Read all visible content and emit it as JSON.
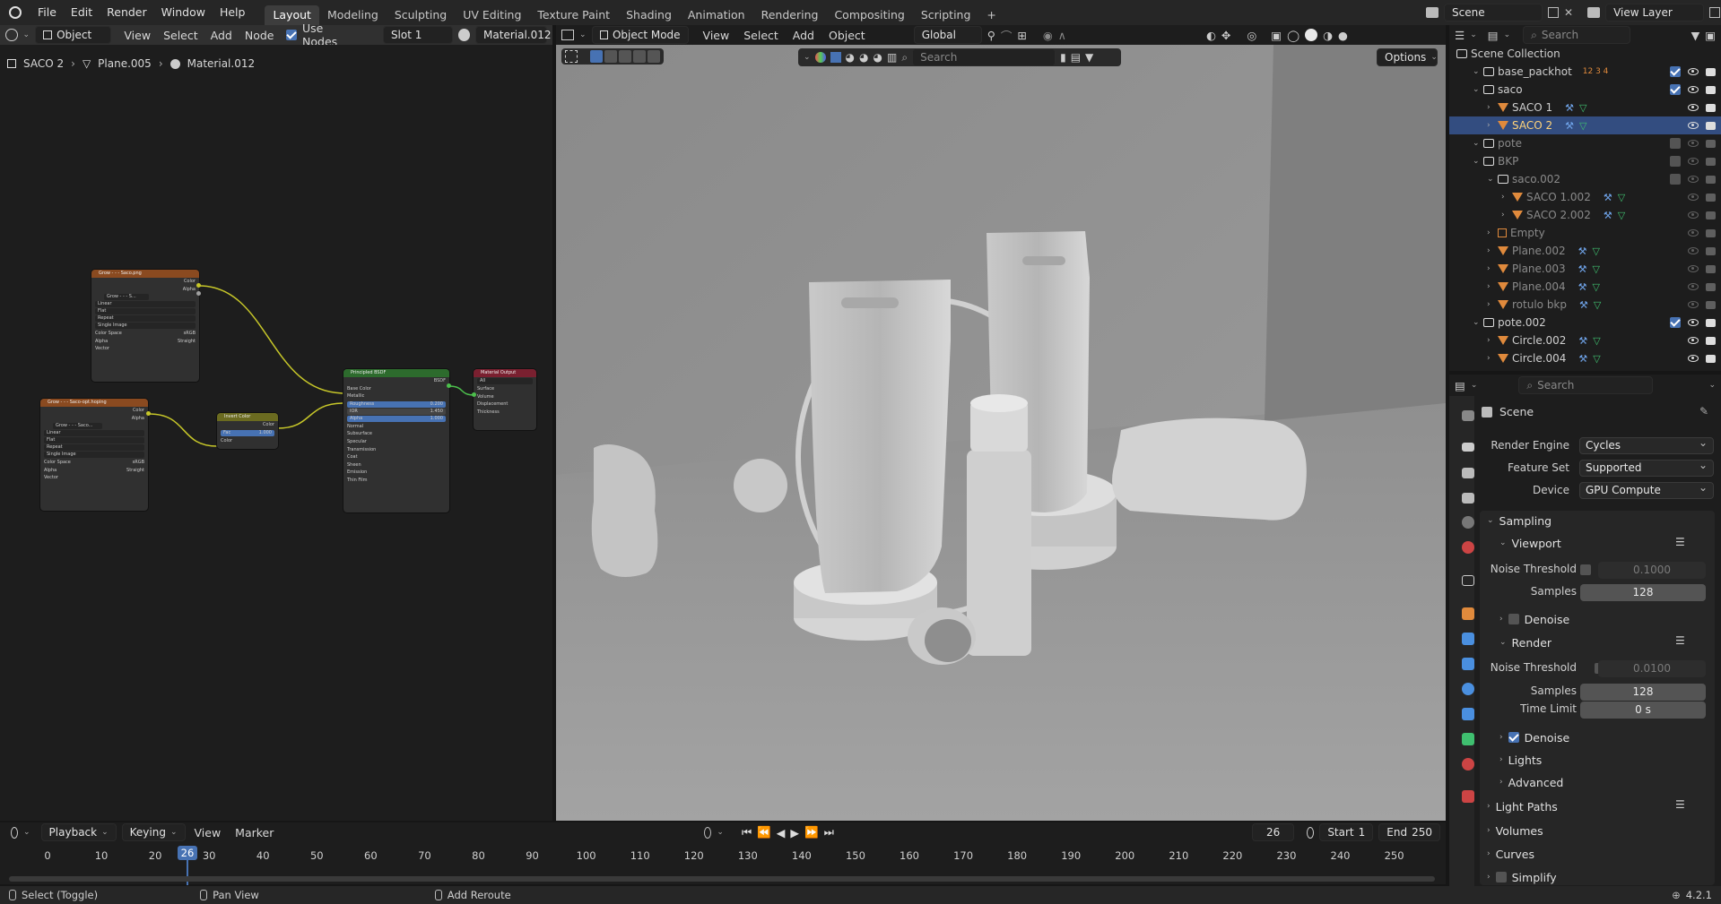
{
  "topbar": {
    "menus": [
      "File",
      "Edit",
      "Render",
      "Window",
      "Help"
    ],
    "workspaces": [
      "Layout",
      "Modeling",
      "Sculpting",
      "UV Editing",
      "Texture Paint",
      "Shading",
      "Animation",
      "Rendering",
      "Compositing",
      "Scripting"
    ],
    "active_workspace": "Layout",
    "add_tab": "+",
    "scene": "Scene",
    "view_layer": "View Layer"
  },
  "node_editor": {
    "mode": "Object",
    "menus": [
      "View",
      "Select",
      "Add",
      "Node"
    ],
    "use_nodes": "Use Nodes",
    "slot": "Slot 1",
    "material": "Material.012",
    "breadcrumb": [
      "SACO 2",
      "Plane.005",
      "Material.012"
    ],
    "nodes": {
      "tex1": {
        "title": "Grow - - - Saco.png",
        "outputs": [
          "Color",
          "Alpha"
        ],
        "image": "Grow - - - S...",
        "fields": [
          "Linear",
          "Flat",
          "Repeat",
          "Single Image"
        ],
        "color_space_label": "Color Space",
        "color_space": "sRGB",
        "alpha_label": "Alpha",
        "alpha": "Straight",
        "input": "Vector"
      },
      "tex2": {
        "title": "Grow - - - Saco-opt.hoping",
        "outputs": [
          "Color",
          "Alpha"
        ],
        "image": "Grow - - - Saco...",
        "fields": [
          "Linear",
          "Flat",
          "Repeat",
          "Single Image"
        ],
        "color_space_label": "Color Space",
        "color_space": "sRGB",
        "alpha_label": "Alpha",
        "alpha": "Straight",
        "input": "Vector"
      },
      "invert": {
        "title": "Invert Color",
        "output": "Color",
        "fac_label": "Fac",
        "fac": "1.000",
        "input": "Color"
      },
      "bsdf": {
        "title": "Principled BSDF",
        "output": "BSDF",
        "rows": [
          "Base Color",
          "Metallic"
        ],
        "roughness_label": "Roughness",
        "roughness": "0.200",
        "ior_label": "IOR",
        "ior": "1.450",
        "alpha_label": "Alpha",
        "alpha": "1.000",
        "normal": "Normal",
        "subs": [
          "Subsurface",
          "Specular",
          "Transmission",
          "Coat",
          "Sheen",
          "Emission",
          "Thin Film"
        ]
      },
      "output": {
        "title": "Material Output",
        "target": "All",
        "inputs": [
          "Surface",
          "Volume",
          "Displacement",
          "Thickness"
        ]
      }
    }
  },
  "viewport": {
    "mode": "Object Mode",
    "menus": [
      "View",
      "Select",
      "Add",
      "Object"
    ],
    "transform": "Global",
    "search_placeholder": "Search",
    "options": "Options"
  },
  "outliner": {
    "search_placeholder": "Search",
    "root": "Scene Collection",
    "rows": [
      {
        "name": "base_packhot",
        "indent": 1,
        "type": "collection",
        "extra": "12 3 4"
      },
      {
        "name": "saco",
        "indent": 1,
        "type": "collection"
      },
      {
        "name": "SACO 1",
        "indent": 2,
        "type": "mesh"
      },
      {
        "name": "SACO 2",
        "indent": 2,
        "type": "mesh",
        "selected": true
      },
      {
        "name": "pote",
        "indent": 1,
        "type": "collection",
        "dim": true
      },
      {
        "name": "BKP",
        "indent": 1,
        "type": "collection",
        "dim": true
      },
      {
        "name": "saco.002",
        "indent": 2,
        "type": "collection",
        "dim": true
      },
      {
        "name": "SACO 1.002",
        "indent": 3,
        "type": "mesh",
        "dim": true
      },
      {
        "name": "SACO 2.002",
        "indent": 3,
        "type": "mesh",
        "dim": true
      },
      {
        "name": "Empty",
        "indent": 2,
        "type": "empty",
        "dim": true
      },
      {
        "name": "Plane.002",
        "indent": 2,
        "type": "mesh",
        "dim": true
      },
      {
        "name": "Plane.003",
        "indent": 2,
        "type": "mesh",
        "dim": true
      },
      {
        "name": "Plane.004",
        "indent": 2,
        "type": "mesh",
        "dim": true
      },
      {
        "name": "rotulo bkp",
        "indent": 2,
        "type": "mesh",
        "dim": true
      },
      {
        "name": "pote.002",
        "indent": 1,
        "type": "collection"
      },
      {
        "name": "Circle.002",
        "indent": 2,
        "type": "mesh"
      },
      {
        "name": "Circle.004",
        "indent": 2,
        "type": "mesh"
      }
    ]
  },
  "properties": {
    "search_placeholder": "Search",
    "context": "Scene",
    "render_engine_label": "Render Engine",
    "render_engine": "Cycles",
    "feature_set_label": "Feature Set",
    "feature_set": "Supported",
    "device_label": "Device",
    "device": "GPU Compute",
    "sampling": "Sampling",
    "viewport": "Viewport",
    "noise_threshold_label": "Noise Threshold",
    "vp_noise": "0.1000",
    "samples_label": "Samples",
    "vp_samples": "128",
    "denoise": "Denoise",
    "render": "Render",
    "r_noise": "0.0100",
    "r_samples": "128",
    "time_limit_label": "Time Limit",
    "time_limit": "0 s",
    "lights": "Lights",
    "advanced": "Advanced",
    "light_paths": "Light Paths",
    "volumes": "Volumes",
    "curves": "Curves",
    "simplify": "Simplify"
  },
  "timeline": {
    "menus": [
      "Playback",
      "Keying",
      "View",
      "Marker"
    ],
    "current_frame": "26",
    "start_label": "Start",
    "start": "1",
    "end_label": "End",
    "end": "250",
    "ticks": [
      "0",
      "10",
      "20",
      "30",
      "40",
      "50",
      "60",
      "70",
      "80",
      "90",
      "100",
      "110",
      "120",
      "130",
      "140",
      "150",
      "160",
      "170",
      "180",
      "190",
      "200",
      "210",
      "220",
      "230",
      "240",
      "250"
    ]
  },
  "status": {
    "select": "Select (Toggle)",
    "pan": "Pan View",
    "reroute": "Add Reroute",
    "version": "4.2.1"
  }
}
